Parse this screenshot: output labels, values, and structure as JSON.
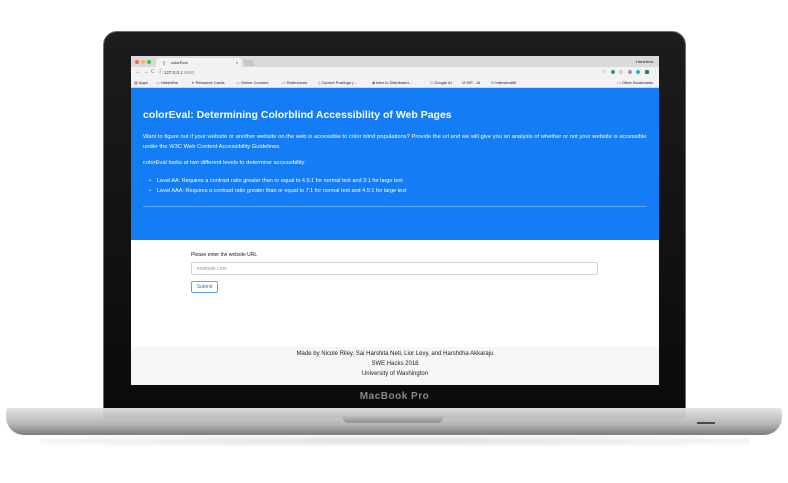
{
  "device": {
    "brand_label": "MacBook Pro"
  },
  "browser": {
    "tab_title": "colorEval",
    "tab_close_glyph": "×",
    "profile_name": "Harshitha",
    "url_host": "127.0.0.1",
    "url_port": ":5000",
    "nav": {
      "back": "←",
      "forward": "→",
      "reload": "C",
      "info": "ⓘ"
    },
    "window_controls_colors": [
      "#fc605b",
      "#fdbc40",
      "#34c84a"
    ],
    "toolbar_icon_colors": [
      "#30a14e",
      "#cfcfcf",
      "#9a9a9a",
      "#1fb8c9",
      "#2d7f3c"
    ],
    "bookmarks": [
      {
        "icon": "▦",
        "label": "Apps"
      },
      {
        "icon": "▭",
        "label": "Harshitha"
      },
      {
        "icon": "★",
        "label": "Resource Cards"
      },
      {
        "icon": "▭",
        "label": "Online Courses"
      },
      {
        "icon": "▭",
        "label": "References"
      },
      {
        "icon": "▯",
        "label": "Current Postings (..."
      },
      {
        "icon": "◆",
        "label": "Intro to Distributed..."
      },
      {
        "icon": "G",
        "label": "Google AI"
      },
      {
        "icon": "M",
        "label": "MIT - AI"
      },
      {
        "icon": "✉",
        "label": "InterviewBit"
      }
    ],
    "other_bookmarks": "Other Bookmarks"
  },
  "page": {
    "accent_color": "#147cf4",
    "hero": {
      "title": "colorEval: Determining Colorblind Accessibility of Web Pages",
      "intro": "Want to figure out if your website or another website on the web is accessible to color blind populations? Provide the url and we will give you an analysis of whether or not your website is accessible under the W3C Web Content Accessibility Guidelines.",
      "levels_intro": "colorEval looks at two different levels to determine accessibility:",
      "levels": [
        "Level AA: Requires a contrast ratio greater than or equal to 4.5:1 for normal text and 3:1 for large text",
        "Level AAA: Requires a contrast ratio greater than or equal to 7:1 for normal text and 4.5:1 for large text"
      ]
    },
    "form": {
      "label": "Please enter the website URL",
      "placeholder": "example.com",
      "value": "",
      "submit_label": "Submit"
    },
    "footer": {
      "credits": "Made by Nicole Riley, Sai Harshita Neti, Lior Levy, and Harshitha Akkaraju",
      "event": "SWE Hacks 2018",
      "school": "University of Washington"
    }
  }
}
